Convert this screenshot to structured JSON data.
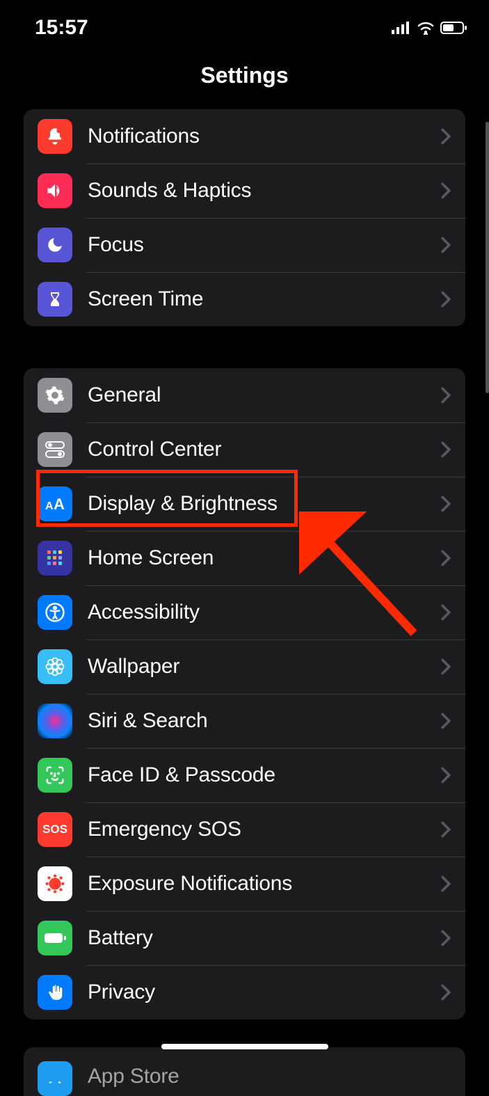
{
  "status": {
    "time": "15:57"
  },
  "header": {
    "title": "Settings"
  },
  "group1": [
    {
      "label": "Notifications",
      "icon": "bell-icon",
      "color": "#ff3b30"
    },
    {
      "label": "Sounds & Haptics",
      "icon": "speaker-icon",
      "color": "#ff2d55"
    },
    {
      "label": "Focus",
      "icon": "moon-icon",
      "color": "#5856d6"
    },
    {
      "label": "Screen Time",
      "icon": "hourglass-icon",
      "color": "#5856d6"
    }
  ],
  "group2": [
    {
      "label": "General",
      "icon": "gear-icon",
      "color": "#8e8e93"
    },
    {
      "label": "Control Center",
      "icon": "switches-icon",
      "color": "#8e8e93"
    },
    {
      "label": "Display & Brightness",
      "icon": "text-size-icon",
      "color": "#007aff"
    },
    {
      "label": "Home Screen",
      "icon": "grid-icon",
      "color": "#3a3a9e"
    },
    {
      "label": "Accessibility",
      "icon": "accessibility-icon",
      "color": "#007aff"
    },
    {
      "label": "Wallpaper",
      "icon": "flower-icon",
      "color": "#38bdf8"
    },
    {
      "label": "Siri & Search",
      "icon": "siri-icon",
      "color": "#1c1c1e"
    },
    {
      "label": "Face ID & Passcode",
      "icon": "faceid-icon",
      "color": "#34c759"
    },
    {
      "label": "Emergency SOS",
      "icon": "sos-icon",
      "color": "#ff3b30"
    },
    {
      "label": "Exposure Notifications",
      "icon": "exposure-icon",
      "color": "#ffffff"
    },
    {
      "label": "Battery",
      "icon": "battery-icon",
      "color": "#34c759"
    },
    {
      "label": "Privacy",
      "icon": "hand-icon",
      "color": "#007aff"
    }
  ],
  "group3": [
    {
      "label": "App Store",
      "icon": "appstore-icon",
      "color": "#1e9df0"
    }
  ],
  "annotations": {
    "highlighted_item": "Display & Brightness"
  }
}
